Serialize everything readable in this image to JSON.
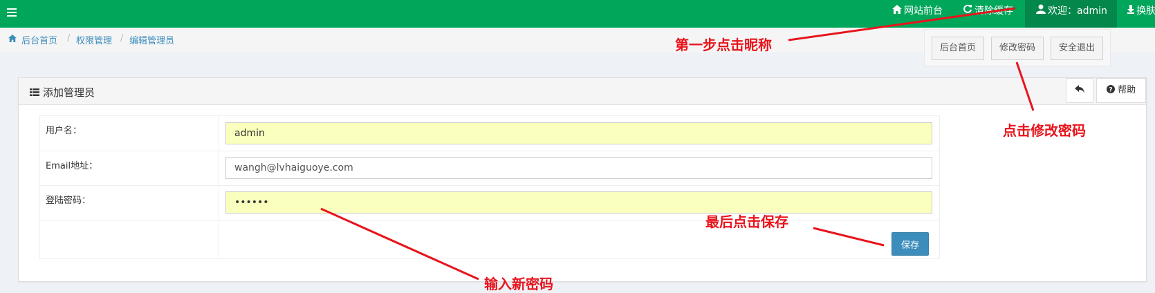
{
  "topbar": {
    "accent": "#00a65a",
    "menu_icon": "hamburger-icon",
    "items": [
      {
        "icon": "home-icon",
        "label": "网站前台"
      },
      {
        "icon": "refresh-icon",
        "label": "清除缓存"
      },
      {
        "icon": "user-icon",
        "label": "欢迎：admin"
      },
      {
        "icon": "download-icon",
        "label": "换肤"
      }
    ]
  },
  "dropdown": {
    "items": [
      "后台首页",
      "修改密码",
      "安全退出"
    ]
  },
  "breadcrumb": {
    "icon": "home-icon",
    "items": [
      "后台首页",
      "权限管理",
      "编辑管理员"
    ],
    "separator": "/"
  },
  "panel": {
    "title_icon": "list-icon",
    "title": "添加管理员",
    "back_icon": "reply-icon",
    "help_icon": "question-circle-icon",
    "help_label": "帮助"
  },
  "form": {
    "username_label": "用户名：",
    "username_value": "admin",
    "email_label": "Email地址：",
    "email_value": "wangh@lvhaiguoye.com",
    "password_label": "登陆密码：",
    "password_value": "••••••",
    "save_label": "保存"
  },
  "annotations": {
    "color": "#e8141c",
    "step1": "第一步点击昵称",
    "step2": "点击修改密码",
    "step3": "输入新密码",
    "step4": "最后点击保存"
  }
}
